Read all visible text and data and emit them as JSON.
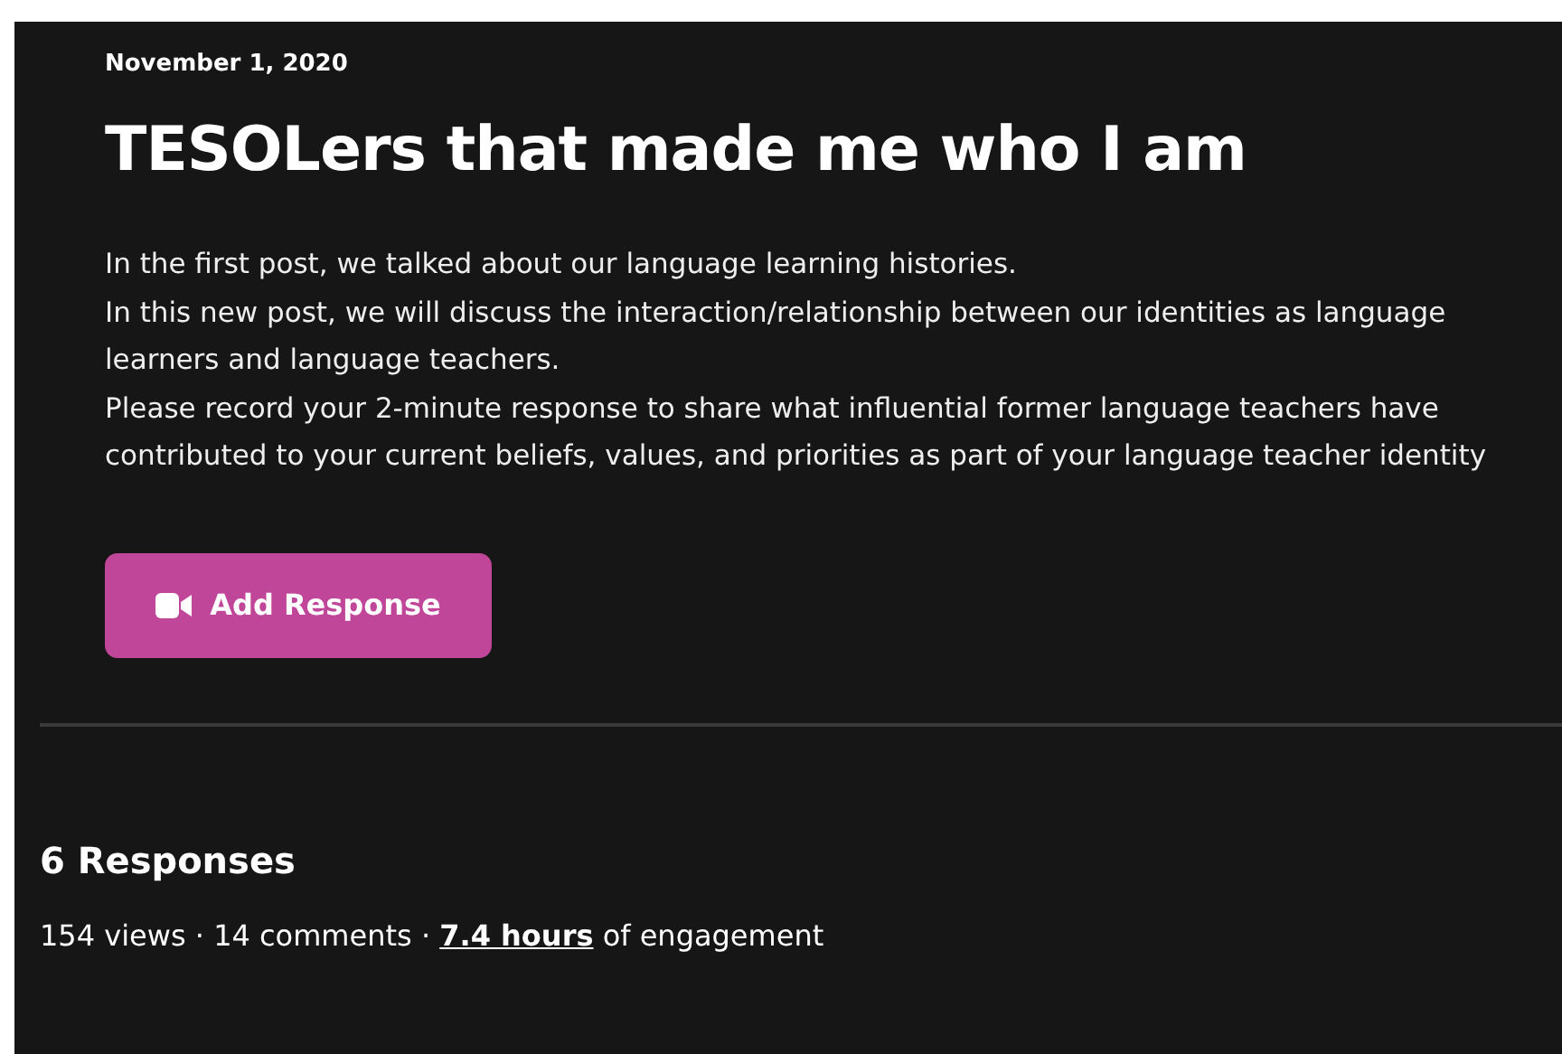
{
  "post": {
    "date": "November 1, 2020",
    "title": "TESOLers that made me who I am",
    "paragraphs": [
      "In the first post, we talked about our language learning histories.",
      "In this new post, we will discuss the interaction/relationship between our identities as language learners and language teachers.",
      "Please record your 2-minute response to share what influential former language teachers have contributed to your current beliefs, values, and priorities as part of your language teacher identity"
    ],
    "button": {
      "label": "Add Response"
    }
  },
  "responses": {
    "heading": "6 Responses",
    "stats_before": "154 views · 14 comments · ",
    "stats_link": "7.4 hours",
    "stats_after": " of engagement"
  }
}
